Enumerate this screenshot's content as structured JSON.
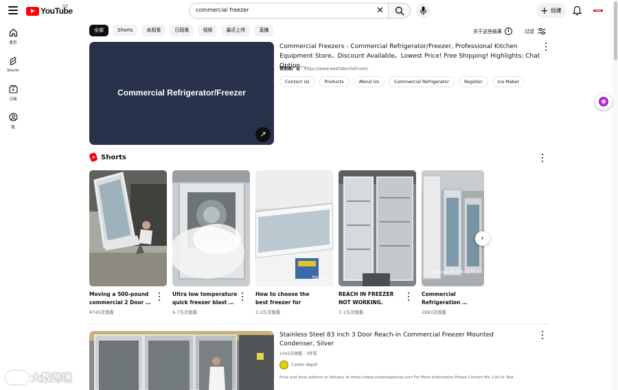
{
  "header": {
    "logo_text": "YouTube",
    "region": "DE",
    "search_query": "commercial freezer",
    "create_label": "创建"
  },
  "sidebar": {
    "items": [
      {
        "label": "首页",
        "icon": "home-icon"
      },
      {
        "label": "Shorts",
        "icon": "shorts-icon"
      },
      {
        "label": "订阅",
        "icon": "subscriptions-icon"
      },
      {
        "label": "我",
        "icon": "you-icon"
      }
    ]
  },
  "filters": {
    "chips": [
      "全部",
      "Shorts",
      "未观看",
      "已观看",
      "视频",
      "最近上传",
      "直播"
    ],
    "active": "全部",
    "about_label": "关于这些结果",
    "filter_label": "过滤"
  },
  "ad": {
    "thumb_title": "Commercial Refrigerator/Freezer",
    "title": "Commercial Freezers - Commercial Refrigerator/Freezer, Professional Kitchen Equipment Store。Discount Available。Lowest Price! Free Shipping! Highlights: Chat Option…",
    "sponsor_label": "赞助商广告",
    "url": "https://www.westlakechef.com/",
    "links": [
      "Contact Us",
      "Products",
      "About Us",
      "Commercial Refrigerator",
      "Register",
      "Ice Maker"
    ]
  },
  "shorts": {
    "heading": "Shorts",
    "items": [
      {
        "title": "Moving a 500-pound commercial 2 Door …",
        "views": "8745次观看"
      },
      {
        "title": "Ultra low temperature quick freezer blast …",
        "views": "6.7万次观看"
      },
      {
        "title": "How to choose the best freezer for business",
        "views": "2.2万次观看"
      },
      {
        "title": "REACH IN FREEZER NOT WORKING. #hvac…",
        "views": "3.1万次观看"
      },
      {
        "title": "Commercial Refrigeration …",
        "views": "2893次观看"
      }
    ],
    "overlay_texts": [
      "TikTok",
      "George 86 176 6177 17"
    ]
  },
  "video": {
    "title": "Stainless Steel 83 inch 3 Door Reach-in Commercial Freezer Mounted Condenser, Silver",
    "meta": "1042次观看 · 3年前",
    "channel": "Cooler depot",
    "description": "Price and local address or delivery at https://www.coolerdepotusa.com For More Information Please Contact Me, Call Or Text …"
  },
  "watermark": "大数跨境"
}
